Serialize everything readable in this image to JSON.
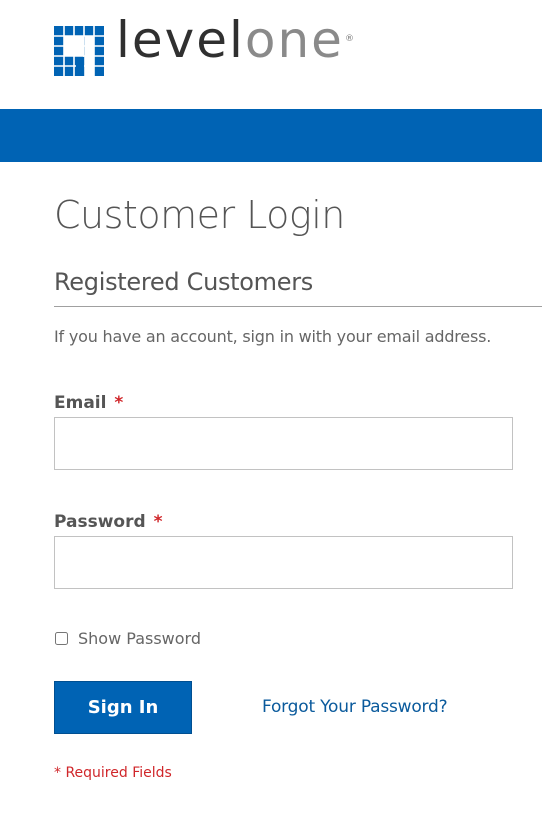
{
  "brand": {
    "logo_dark_text": "level",
    "logo_light_text": "one",
    "logo_mark": "®",
    "color_primary": "#0063b4",
    "color_required": "#d0262a"
  },
  "page": {
    "title": "Customer Login"
  },
  "login_block": {
    "title": "Registered Customers",
    "intro": "If you have an account, sign in with your email address.",
    "required_mark": "*"
  },
  "email": {
    "label": "Email",
    "value": "",
    "placeholder": ""
  },
  "password": {
    "label": "Password",
    "value": "",
    "placeholder": ""
  },
  "show_password": {
    "label": "Show Password",
    "checked": false
  },
  "actions": {
    "sign_in_label": "Sign In",
    "forgot_label": "Forgot Your Password?"
  },
  "footer": {
    "required_note": "* Required Fields"
  }
}
